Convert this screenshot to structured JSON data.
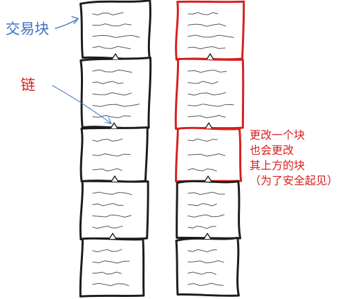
{
  "labels": {
    "transaction_block": "交易块",
    "chain": "链"
  },
  "annotation": {
    "lines": [
      "更改一个块",
      "也会更改",
      "其上方的块",
      "（为了安全起见）"
    ]
  },
  "colors": {
    "black": "#1c1c1c",
    "red": "#d71f1f",
    "blue": "#3f6fc5",
    "pencil": "#555555"
  },
  "columns": [
    {
      "name": "original-chain",
      "blocks": [
        "black",
        "black",
        "black",
        "black",
        "black"
      ]
    },
    {
      "name": "tampered-chain",
      "blocks": [
        "red",
        "red",
        "red",
        "black",
        "black"
      ]
    }
  ]
}
